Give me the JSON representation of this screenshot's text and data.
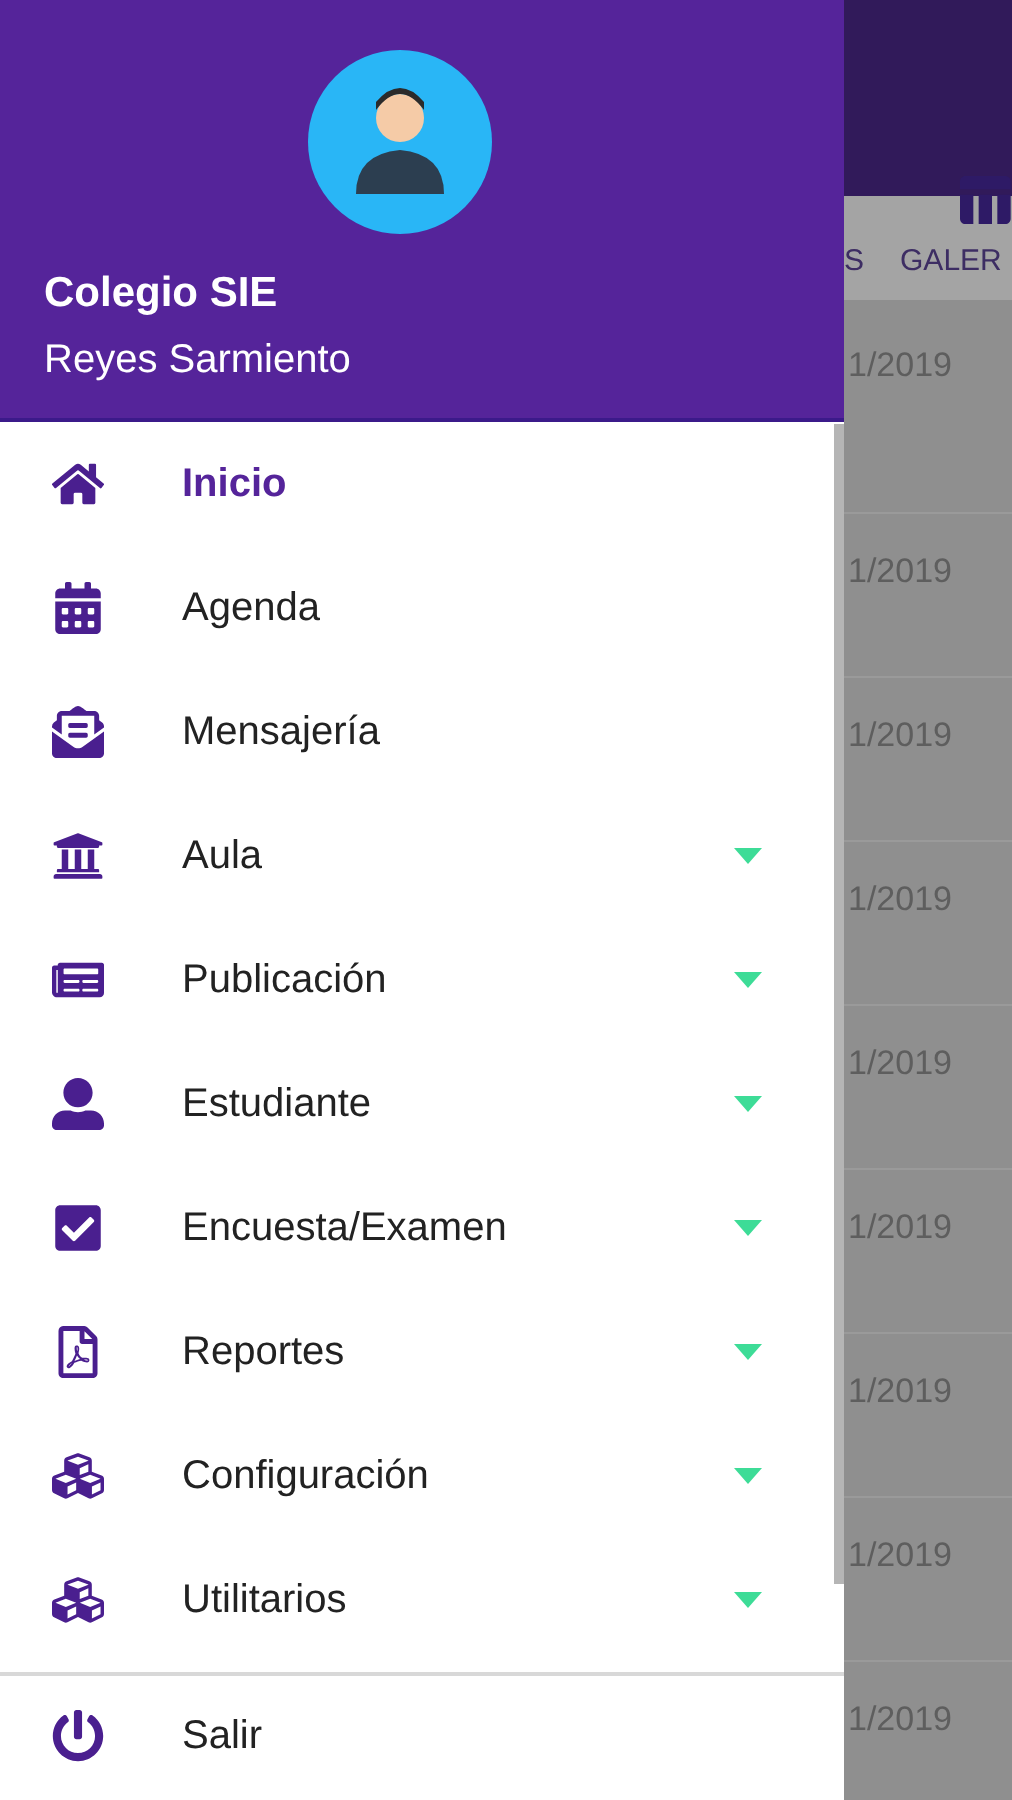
{
  "drawer": {
    "title": "Colegio SIE",
    "subtitle": "Reyes Sarmiento",
    "items": [
      {
        "label": "Inicio",
        "selected": true,
        "expandable": false
      },
      {
        "label": "Agenda",
        "selected": false,
        "expandable": false
      },
      {
        "label": "Mensajería",
        "selected": false,
        "expandable": false
      },
      {
        "label": "Aula",
        "selected": false,
        "expandable": true
      },
      {
        "label": "Publicación",
        "selected": false,
        "expandable": true
      },
      {
        "label": "Estudiante",
        "selected": false,
        "expandable": true
      },
      {
        "label": "Encuesta/Examen",
        "selected": false,
        "expandable": true
      },
      {
        "label": "Reportes",
        "selected": false,
        "expandable": true
      },
      {
        "label": "Configuración",
        "selected": false,
        "expandable": true
      },
      {
        "label": "Utilitarios",
        "selected": false,
        "expandable": true
      }
    ],
    "logout": {
      "label": "Salir"
    }
  },
  "background": {
    "tabs": [
      {
        "label": "S"
      },
      {
        "label": "GALER"
      }
    ],
    "rows": [
      {
        "date": "1/2019"
      },
      {
        "date": "1/2019"
      },
      {
        "date": "1/2019"
      },
      {
        "date": "1/2019"
      },
      {
        "date": "1/2019"
      },
      {
        "date": "1/2019"
      },
      {
        "date": "1/2019"
      },
      {
        "date": "1/2019"
      },
      {
        "date": "1/2019"
      }
    ]
  }
}
